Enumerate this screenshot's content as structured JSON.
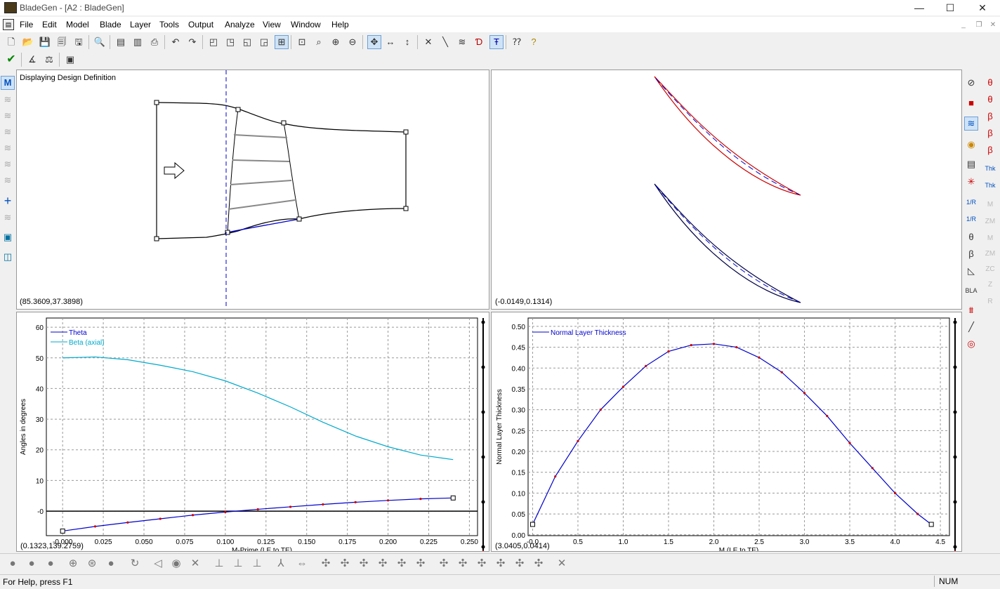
{
  "window": {
    "title": "BladeGen - [A2 : BladeGen]",
    "minimize": "—",
    "maximize": "☐",
    "close": "✕"
  },
  "menu": [
    "File",
    "Edit",
    "Model",
    "Blade",
    "Layer",
    "Tools",
    "Output",
    "Analyze",
    "View",
    "Window",
    "Help"
  ],
  "mdi_controls": [
    "_",
    "❐",
    "✕"
  ],
  "panels": {
    "meridional": {
      "caption": "Displaying Design Definition",
      "coord": "(85.3609,37.3898)"
    },
    "blade_to_blade": {
      "coord": "(-0.0149,0.1314)"
    },
    "angles": {
      "coord": "(0.1323,139.2759)",
      "chart_data": {
        "type": "line",
        "xlabel": "M-Prime (LE to TE)",
        "ylabel": "Angles in degrees",
        "xlim": [
          -0.01,
          0.255
        ],
        "ylim": [
          -8,
          63
        ],
        "xticks": [
          "-0.000",
          "0.025",
          "0.050",
          "0.075",
          "0.100",
          "0.125",
          "0.150",
          "0.175",
          "0.200",
          "0.225",
          "0.250"
        ],
        "xtick_values": [
          0,
          0.025,
          0.05,
          0.075,
          0.1,
          0.125,
          0.15,
          0.175,
          0.2,
          0.225,
          0.25
        ],
        "yticks": [
          "60",
          "50",
          "40",
          "30",
          "20",
          "10",
          "-0"
        ],
        "ytick_values": [
          60,
          50,
          40,
          30,
          20,
          10,
          0
        ],
        "grid": true,
        "legend": "top-left",
        "series": [
          {
            "name": "Theta",
            "color": "#0000cc",
            "x": [
              0,
              0.02,
              0.04,
              0.06,
              0.08,
              0.1,
              0.12,
              0.14,
              0.16,
              0.18,
              0.2,
              0.22,
              0.24
            ],
            "y": [
              -6.5,
              -5.0,
              -3.7,
              -2.5,
              -1.3,
              -0.3,
              0.6,
              1.4,
              2.2,
              2.9,
              3.5,
              4.0,
              4.3
            ]
          },
          {
            "name": "Beta (axial)",
            "color": "#00aacc",
            "x": [
              0,
              0.02,
              0.04,
              0.06,
              0.08,
              0.1,
              0.12,
              0.14,
              0.16,
              0.18,
              0.2,
              0.22,
              0.24
            ],
            "y": [
              50,
              50.3,
              49.4,
              47.6,
              45.5,
              42.5,
              38.5,
              34.0,
              29.0,
              24.5,
              21.0,
              18.3,
              16.8
            ]
          }
        ]
      }
    },
    "thickness": {
      "coord": "(3.0405,0.0414)",
      "chart_data": {
        "type": "line",
        "xlabel": "M (LE to TE)",
        "ylabel": "Normal Layer Thickness",
        "xlim": [
          -0.05,
          4.6
        ],
        "ylim": [
          -0.002,
          0.52
        ],
        "xticks": [
          "-0.0",
          "0.5",
          "1.0",
          "1.5",
          "2.0",
          "2.5",
          "3.0",
          "3.5",
          "4.0",
          "4.5"
        ],
        "xtick_values": [
          0,
          0.5,
          1,
          1.5,
          2,
          2.5,
          3,
          3.5,
          4,
          4.5
        ],
        "yticks": [
          "0.50",
          "0.45",
          "0.40",
          "0.35",
          "0.30",
          "0.25",
          "0.20",
          "0.15",
          "0.10",
          "0.05",
          "0.00"
        ],
        "ytick_values": [
          0.5,
          0.45,
          0.4,
          0.35,
          0.3,
          0.25,
          0.2,
          0.15,
          0.1,
          0.05,
          0
        ],
        "grid": true,
        "legend": "top-left",
        "series": [
          {
            "name": "Normal Layer Thickness",
            "color": "#0000cc",
            "x": [
              0,
              0.25,
              0.5,
              0.75,
              1.0,
              1.25,
              1.5,
              1.75,
              2.0,
              2.25,
              2.5,
              2.75,
              3.0,
              3.25,
              3.5,
              3.75,
              4.0,
              4.25,
              4.4
            ],
            "y": [
              0.025,
              0.14,
              0.225,
              0.3,
              0.355,
              0.405,
              0.44,
              0.455,
              0.458,
              0.45,
              0.425,
              0.39,
              0.34,
              0.285,
              0.22,
              0.16,
              0.1,
              0.05,
              0.025
            ]
          }
        ]
      }
    }
  },
  "status": {
    "help": "For Help, press F1",
    "num": "NUM"
  }
}
